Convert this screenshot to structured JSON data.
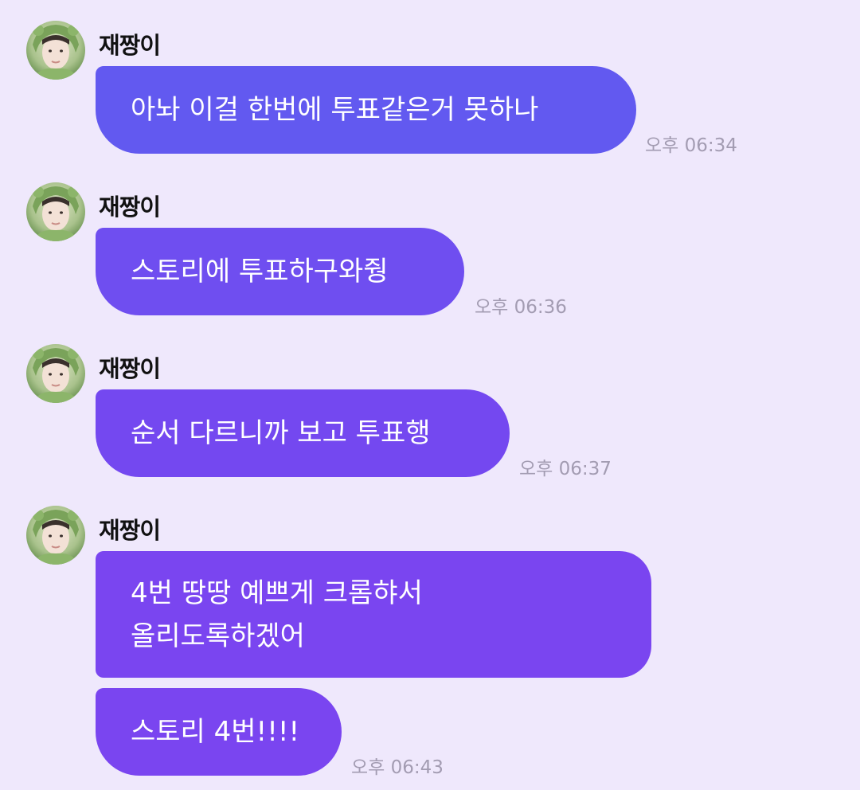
{
  "colors": {
    "background": "#efe8fc",
    "bubble_1": "#6259f0",
    "bubble_2": "#6f4ef0",
    "bubble_3": "#7448f0",
    "bubble_4": "#7a45f0",
    "timestamp": "#a39cb2"
  },
  "messages": [
    {
      "sender": "재짱이",
      "avatar_icon": "profile-photo",
      "lines": [
        "아놔 이걸 한번에 투표같은거 못하나"
      ],
      "time": "오후 06:34"
    },
    {
      "sender": "재짱이",
      "avatar_icon": "profile-photo",
      "lines": [
        "스토리에 투표하구와줭"
      ],
      "time": "오후 06:36"
    },
    {
      "sender": "재짱이",
      "avatar_icon": "profile-photo",
      "lines": [
        "순서 다르니까 보고 투표행"
      ],
      "time": "오후 06:37"
    },
    {
      "sender": "재짱이",
      "avatar_icon": "profile-photo",
      "lines": [
        "4번 땅땅 예쁘게 크롬햐서",
        "올리도록하겠어"
      ],
      "time": ""
    },
    {
      "lines": [
        "스토리 4번!!!!"
      ],
      "time": "오후 06:43"
    }
  ]
}
